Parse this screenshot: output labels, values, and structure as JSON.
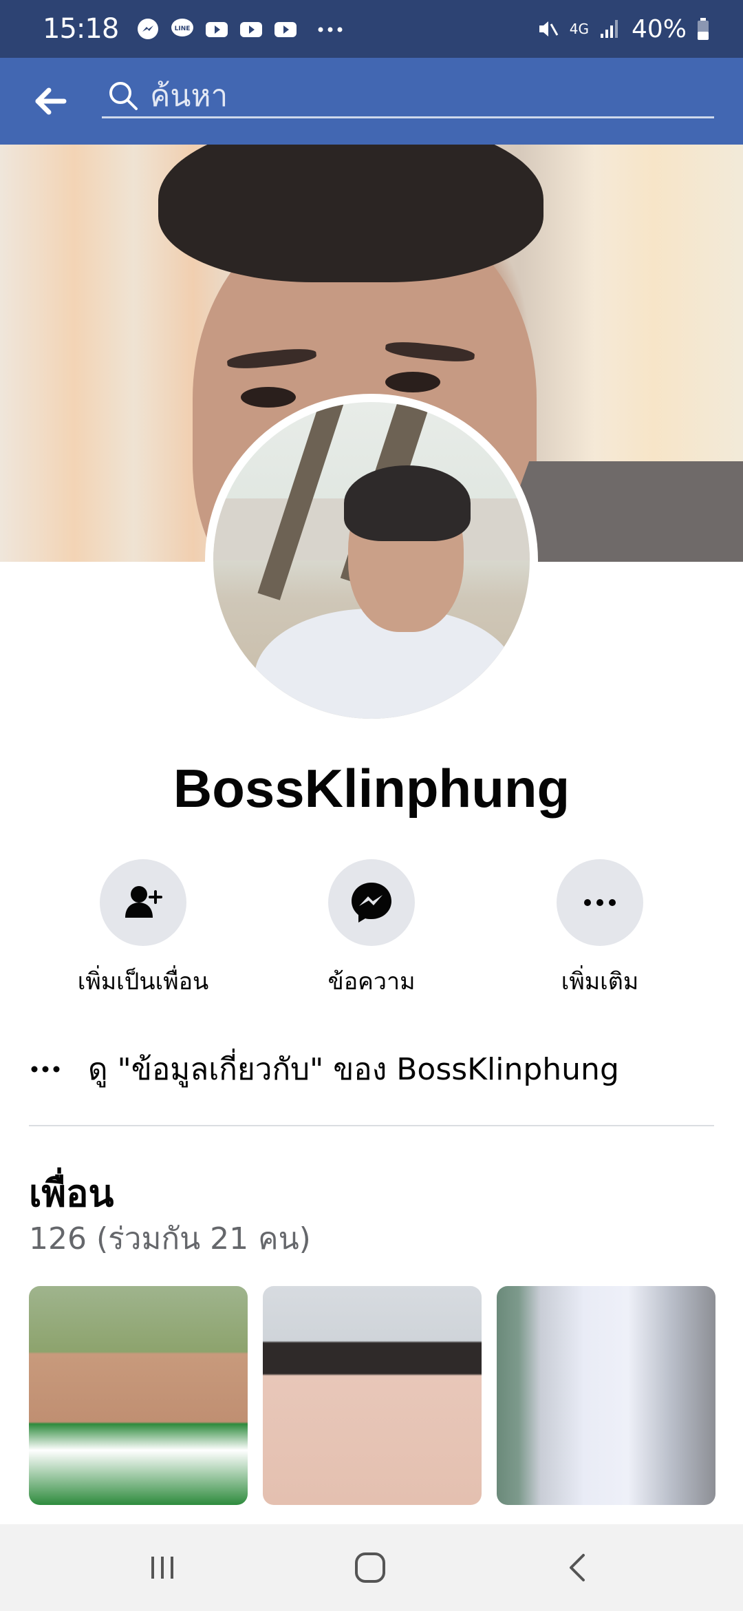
{
  "status_bar": {
    "time": "15:18",
    "notification_icons": [
      "messenger-icon",
      "line-icon",
      "youtube-icon",
      "youtube-icon",
      "youtube-icon",
      "more-dots-icon"
    ],
    "network": "4G",
    "battery": "40%"
  },
  "app_bar": {
    "search_placeholder": "ค้นหา"
  },
  "profile": {
    "name": "BossKlinphung"
  },
  "actions": [
    {
      "label": "เพิ่มเป็นเพื่อน",
      "icon": "add-friend-icon"
    },
    {
      "label": "ข้อความ",
      "icon": "messenger-icon"
    },
    {
      "label": "เพิ่มเติม",
      "icon": "more-dots-icon"
    }
  ],
  "about": {
    "text": "ดู \"ข้อมูลเกี่ยวกับ\" ของ BossKlinphung"
  },
  "friends": {
    "title": "เพื่อน",
    "count_text": "126 (ร่วมกัน 21 คน)"
  },
  "nav_bar": {
    "buttons": [
      "recent-apps-icon",
      "home-icon",
      "back-icon"
    ]
  },
  "colors": {
    "status_bar": "#2d4373",
    "app_bar": "#4267b2",
    "action_circle": "#e4e6eb",
    "secondary_text": "#65676b"
  }
}
